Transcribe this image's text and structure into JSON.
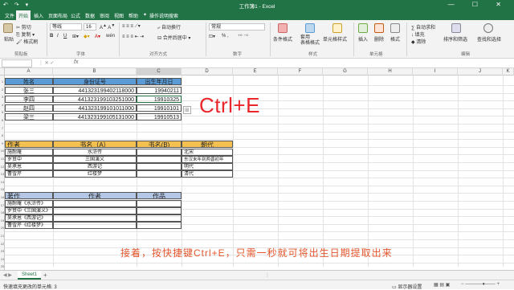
{
  "window": {
    "title": "工作簿1 - Excel",
    "quick_access": "↶ ↷ ▾",
    "controls": "— ☐ ✕"
  },
  "ribbon": {
    "tabs": [
      "文件",
      "开始",
      "插入",
      "页面布局",
      "公式",
      "数据",
      "审阅",
      "视图",
      "帮助",
      "操作说明搜索"
    ],
    "active_tab": "开始",
    "clipboard": {
      "cut": "剪切",
      "copy": "复制 ▾",
      "format_painter": "格式刷",
      "paste": "粘贴",
      "group": "剪贴板"
    },
    "font": {
      "name": "等线",
      "size": "16",
      "bold": "B",
      "italic": "I",
      "underline": "U",
      "wen": "wén",
      "group": "字体"
    },
    "alignment": {
      "wrap": "自动换行",
      "merge": "合并后居中 ▾",
      "group": "对齐方式"
    },
    "number": {
      "format": "常规",
      "symbols": "% ,",
      "group": "数字"
    },
    "styles": {
      "conditional": "条件格式",
      "table": "套用\n表格格式",
      "cell": "单元格样式",
      "group": "样式"
    },
    "cells": {
      "insert": "插入",
      "delete": "删除",
      "format": "格式",
      "group": "单元格"
    },
    "editing": {
      "sum": "∑ 自动求和",
      "fill": "↓ 填充",
      "clear": "◆ 清除",
      "sort": "排序和筛选",
      "find": "查找和选择",
      "group": "编辑"
    }
  },
  "formula_bar": {
    "name_box": "",
    "fx": "fx",
    "content": ""
  },
  "columns": [
    "A",
    "B",
    "C",
    "D",
    "E",
    "F",
    "G",
    "H",
    "I",
    "J",
    "K"
  ],
  "rows": [
    "1",
    "2",
    "3",
    "4",
    "5",
    "6",
    "7",
    "8",
    "9",
    "10",
    "11",
    "12",
    "13",
    "14",
    "15",
    "16",
    "17",
    "18",
    "19",
    "20",
    "21",
    "22",
    "23",
    "24",
    "25"
  ],
  "table1": {
    "headers": [
      "姓名",
      "身份证号",
      "出生年月日"
    ],
    "rows": [
      [
        "张三",
        "441323199402118000",
        "19940211"
      ],
      [
        "李四",
        "441323199103251000",
        "19910325"
      ],
      [
        "赵四",
        "441323199101011000",
        "19910101"
      ],
      [
        "梁三",
        "441323199105131000",
        "19910513"
      ]
    ]
  },
  "table2": {
    "headers": [
      "作者",
      "书名（A）",
      "书名(B)",
      "朝代"
    ],
    "rows": [
      [
        "施耐庵",
        "水浒传",
        "",
        "北宋"
      ],
      [
        "罗贯中",
        "三国演义",
        "",
        "东汉末年到两晋初年"
      ],
      [
        "吴承恩",
        "西游记",
        "",
        "明代"
      ],
      [
        "曹雪芹",
        "红楼梦",
        "",
        "清代"
      ]
    ]
  },
  "table3": {
    "headers": [
      "著作",
      "作者",
      "作品"
    ],
    "rows": [
      [
        "施耐庵《水浒传》",
        "",
        ""
      ],
      [
        "罗贯中《三国演义》",
        "",
        ""
      ],
      [
        "吴承恩《西游记》",
        "",
        ""
      ],
      [
        "曹雪芹《红楼梦》",
        "",
        ""
      ]
    ]
  },
  "overlay": {
    "shortcut": "Ctrl+E",
    "caption": "接着，按快捷键Ctrl+E，只需一秒就可将出生日期提取出来"
  },
  "sheet_tabs": {
    "active": "Sheet1",
    "add": "+"
  },
  "status_bar": {
    "left": "快速填充更改的单元格: 3",
    "right": "显示器设置"
  },
  "colors": {
    "excel_green": "#217346",
    "header_blue": "#5b9bd5",
    "header_gold": "#f4c150",
    "header_lightblue": "#b4c7e7",
    "accent_red": "#e8262b"
  }
}
